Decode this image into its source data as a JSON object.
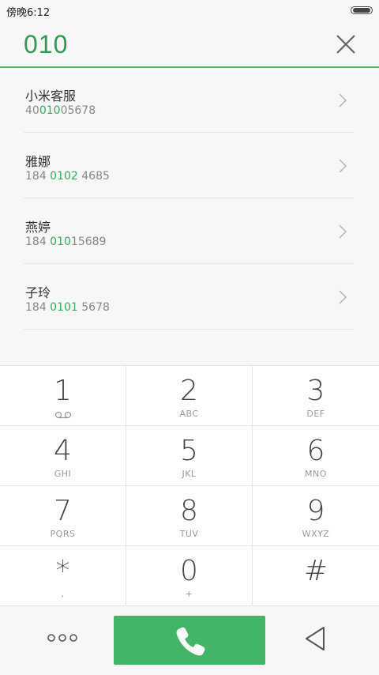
{
  "status_bar": {
    "time": "傍晚6:12"
  },
  "dialer": {
    "input_value": "010"
  },
  "results": [
    {
      "name": "小米客服",
      "number_pre": "40",
      "number_hl": "010",
      "number_post": "05678"
    },
    {
      "name": "雅娜",
      "number_pre": "184 ",
      "number_hl": "0102",
      "number_post": " 4685"
    },
    {
      "name": "燕婷",
      "number_pre": "184 ",
      "number_hl": "010",
      "number_post": "15689"
    },
    {
      "name": "子玲",
      "number_pre": "184 ",
      "number_hl": "0101",
      "number_post": " 5678"
    }
  ],
  "keypad": [
    {
      "digit": "1",
      "sub": ""
    },
    {
      "digit": "2",
      "sub": "ABC"
    },
    {
      "digit": "3",
      "sub": "DEF"
    },
    {
      "digit": "4",
      "sub": "GHI"
    },
    {
      "digit": "5",
      "sub": "JKL"
    },
    {
      "digit": "6",
      "sub": "MNO"
    },
    {
      "digit": "7",
      "sub": "PQRS"
    },
    {
      "digit": "8",
      "sub": "TUV"
    },
    {
      "digit": "9",
      "sub": "WXYZ"
    },
    {
      "digit": "*",
      "sub": ","
    },
    {
      "digit": "0",
      "sub": "+"
    },
    {
      "digit": "#",
      "sub": ""
    }
  ],
  "colors": {
    "accent": "#43b569",
    "highlight": "#3ba85f"
  },
  "icons": {
    "clear": "close-icon",
    "call": "phone-icon",
    "more": "more-dots-icon",
    "back": "back-triangle-icon",
    "voicemail": "voicemail-icon"
  }
}
